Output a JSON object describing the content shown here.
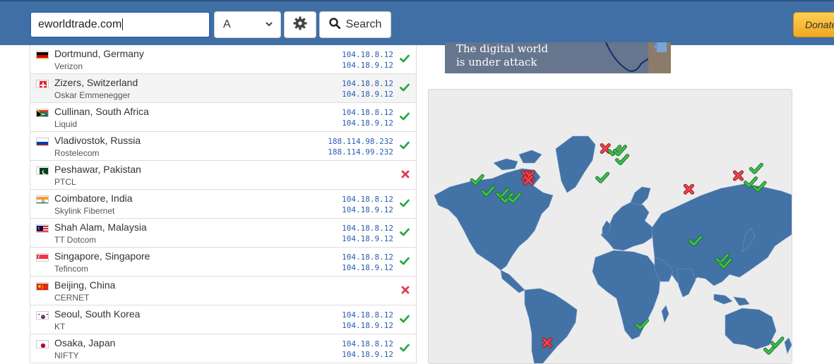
{
  "toolbar": {
    "search_value": "eworldtrade.com",
    "record_type": "A",
    "search_label": "Search",
    "donate_label": "Donate"
  },
  "ad": {
    "line1": "The digital world",
    "line2": "is under attack"
  },
  "results": [
    {
      "city": "Dortmund, Germany",
      "isp": "Verizon",
      "ip1": "104.18.8.12",
      "ip2": "104.18.9.12",
      "status": "ok",
      "flag": "de"
    },
    {
      "city": "Zizers, Switzerland",
      "isp": "Oskar Emmenegger",
      "ip1": "104.18.8.12",
      "ip2": "104.18.9.12",
      "status": "ok",
      "flag": "ch"
    },
    {
      "city": "Cullinan, South Africa",
      "isp": "Liquid",
      "ip1": "104.18.8.12",
      "ip2": "104.18.9.12",
      "status": "ok",
      "flag": "za"
    },
    {
      "city": "Vladivostok, Russia",
      "isp": "Rostelecom",
      "ip1": "188.114.98.232",
      "ip2": "188.114.99.232",
      "status": "ok",
      "flag": "ru"
    },
    {
      "city": "Peshawar, Pakistan",
      "isp": "PTCL",
      "ip1": "",
      "ip2": "",
      "status": "fail",
      "flag": "pk"
    },
    {
      "city": "Coimbatore, India",
      "isp": "Skylink Fibernet",
      "ip1": "104.18.8.12",
      "ip2": "104.18.9.12",
      "status": "ok",
      "flag": "in"
    },
    {
      "city": "Shah Alam, Malaysia",
      "isp": "TT Dotcom",
      "ip1": "104.18.8.12",
      "ip2": "104.18.9.12",
      "status": "ok",
      "flag": "my"
    },
    {
      "city": "Singapore, Singapore",
      "isp": "Tefincom",
      "ip1": "104.18.8.12",
      "ip2": "104.18.9.12",
      "status": "ok",
      "flag": "sg"
    },
    {
      "city": "Beijing, China",
      "isp": "CERNET",
      "ip1": "",
      "ip2": "",
      "status": "fail",
      "flag": "cn"
    },
    {
      "city": "Seoul, South Korea",
      "isp": "KT",
      "ip1": "104.18.8.12",
      "ip2": "104.18.9.12",
      "status": "ok",
      "flag": "kr"
    },
    {
      "city": "Osaka, Japan",
      "isp": "NIFTY",
      "ip1": "104.18.8.12",
      "ip2": "104.18.9.12",
      "status": "ok",
      "flag": "jp"
    }
  ],
  "icons": {
    "ok": "check-icon",
    "fail": "cross-icon",
    "settings": "gear-icon",
    "search": "magnifier-icon"
  },
  "colors": {
    "header": "#3f6fa5",
    "ok": "#27a844",
    "fail": "#e03c4a",
    "ip_link": "#2a5db0",
    "map_land": "#4372a6",
    "map_bg": "#ececec"
  },
  "map_markers": [
    {
      "lon": -122,
      "lat": 38,
      "status": "ok"
    },
    {
      "lon": -112,
      "lat": 33,
      "status": "ok"
    },
    {
      "lon": -99,
      "lat": 32,
      "status": "ok"
    },
    {
      "lon": -95,
      "lat": 30,
      "status": "ok"
    },
    {
      "lon": -88,
      "lat": 30,
      "status": "ok"
    },
    {
      "lon": -77,
      "lat": 40,
      "status": "fail"
    },
    {
      "lon": -74,
      "lat": 40,
      "status": "fail"
    },
    {
      "lon": -75,
      "lat": 38,
      "status": "fail"
    },
    {
      "lon": -5,
      "lat": 52,
      "status": "fail"
    },
    {
      "lon": 3,
      "lat": 51,
      "status": "ok"
    },
    {
      "lon": 8,
      "lat": 51,
      "status": "ok"
    },
    {
      "lon": 10,
      "lat": 47,
      "status": "ok"
    },
    {
      "lon": -8,
      "lat": 39,
      "status": "ok"
    },
    {
      "lon": 71,
      "lat": 34,
      "status": "fail"
    },
    {
      "lon": 77,
      "lat": 11,
      "status": "ok"
    },
    {
      "lon": 101,
      "lat": 3,
      "status": "ok"
    },
    {
      "lon": 104,
      "lat": 1,
      "status": "ok"
    },
    {
      "lon": 116,
      "lat": 40,
      "status": "fail"
    },
    {
      "lon": 127,
      "lat": 37,
      "status": "ok"
    },
    {
      "lon": 132,
      "lat": 43,
      "status": "ok"
    },
    {
      "lon": 135,
      "lat": 35,
      "status": "ok"
    },
    {
      "lon": 28,
      "lat": -26,
      "status": "ok"
    },
    {
      "lon": -58,
      "lat": -34,
      "status": "fail"
    },
    {
      "lon": 145,
      "lat": -37,
      "status": "ok"
    },
    {
      "lon": 151,
      "lat": -34,
      "status": "ok"
    }
  ]
}
